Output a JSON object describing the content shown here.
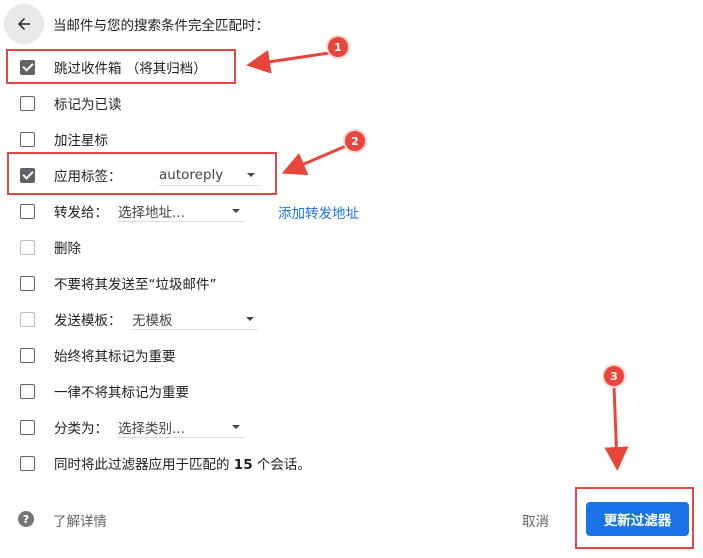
{
  "header": {
    "text": "当邮件与您的搜索条件完全匹配时："
  },
  "options": [
    {
      "label": "跳过收件箱 （将其归档）",
      "checked": true
    },
    {
      "label": "标记为已读",
      "checked": false
    },
    {
      "label": "加注星标",
      "checked": false
    },
    {
      "label": "应用标签：",
      "checked": true,
      "dropdown_value": "autoreply"
    },
    {
      "label": "转发给：",
      "checked": false,
      "dropdown_value": "选择地址...",
      "link": "添加转发地址"
    },
    {
      "label": "删除",
      "checked": false
    },
    {
      "label": "不要将其发送至“垃圾邮件”",
      "checked": false
    },
    {
      "label": "发送模板：",
      "checked": false,
      "dropdown_value": "无模板"
    },
    {
      "label": "始终将其标记为重要",
      "checked": false
    },
    {
      "label": "一律不将其标记为重要",
      "checked": false
    },
    {
      "label": "分类为：",
      "checked": false,
      "dropdown_value": "选择类别..."
    },
    {
      "label_pre": "同时将此过滤器应用于匹配的",
      "label_count": "15",
      "label_post": "个会话。",
      "checked": false
    }
  ],
  "footer": {
    "help_symbol": "?",
    "learn_more": "了解详情",
    "cancel": "取消",
    "update": "更新过滤器"
  },
  "annotations": {
    "badge_1": "1",
    "badge_2": "2",
    "badge_3": "3",
    "highlight_color": "#e04848"
  }
}
